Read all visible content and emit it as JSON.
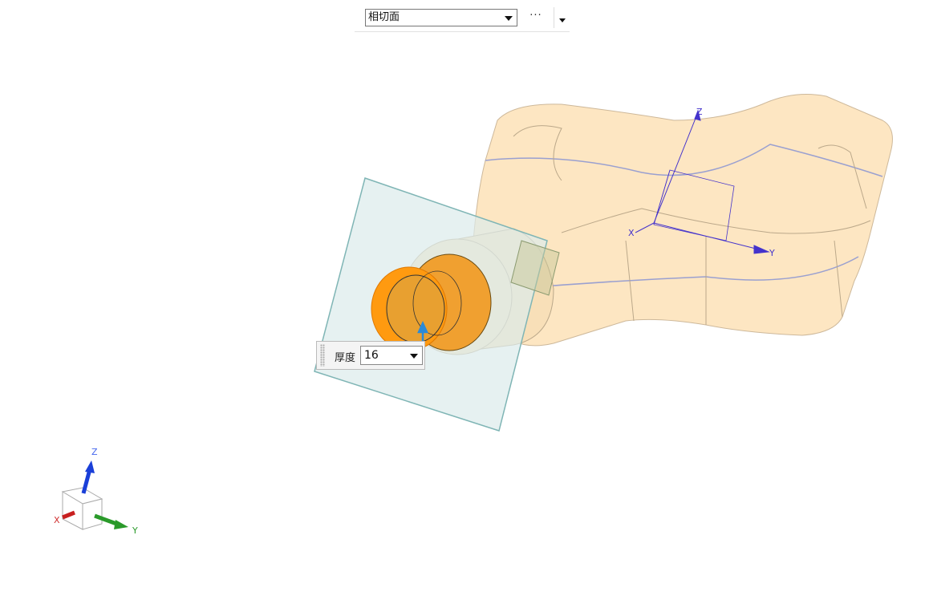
{
  "toolbar": {
    "section_type_value": "相切面",
    "more_label": "···"
  },
  "thickness": {
    "label": "厚度",
    "value": "16"
  },
  "model_axes": {
    "x": "X",
    "y": "Y",
    "z": "Z"
  },
  "triad": {
    "x": "X",
    "y": "Y",
    "z": "Z"
  },
  "colors": {
    "body": "#fde6c2",
    "highlight": "#ff9a10",
    "plane": "#e6f0f0",
    "plane_edge": "#7fb5b5",
    "axis": "#4433cc"
  }
}
